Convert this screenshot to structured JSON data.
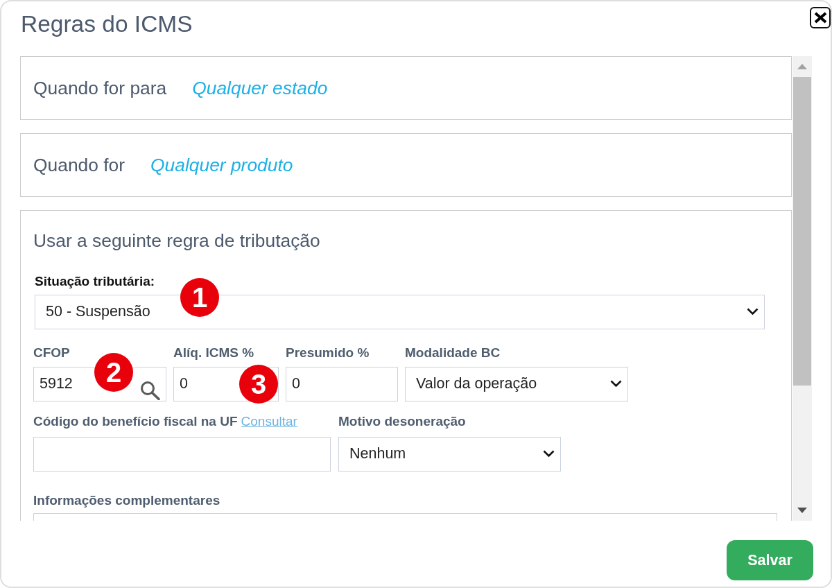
{
  "dialog": {
    "title": "Regras do ICMS"
  },
  "conditions": [
    {
      "label": "Quando for para",
      "value": "Qualquer estado"
    },
    {
      "label": "Quando for",
      "value": "Qualquer produto"
    }
  ],
  "tax_rule": {
    "title": "Usar a seguinte regra de tributação",
    "rows": [
      {
        "fields": [
          {
            "kind": "select",
            "label": "Situação tributária:",
            "value": "50 - Suspensão",
            "marker": "1"
          }
        ]
      },
      {
        "fields": [
          {
            "kind": "search",
            "label": "CFOP",
            "value": "5912",
            "marker": "2"
          },
          {
            "kind": "text",
            "label": "Alíq. ICMS %",
            "value": "0",
            "marker": "3"
          },
          {
            "kind": "text",
            "label": "Presumido %",
            "value": "0"
          },
          {
            "kind": "select",
            "label": "Modalidade BC",
            "value": "Valor da operação"
          }
        ]
      },
      {
        "fields": [
          {
            "kind": "text",
            "label": "Código do benefício fiscal na UF",
            "link": "Consultar"
          },
          {
            "kind": "select",
            "label": "Motivo desoneração",
            "value": "Nenhum"
          }
        ]
      },
      {
        "fields": [
          {
            "kind": "textarea",
            "label": "Informações complementares"
          }
        ]
      }
    ]
  },
  "buttons": [
    {
      "label": "Salvar"
    }
  ]
}
